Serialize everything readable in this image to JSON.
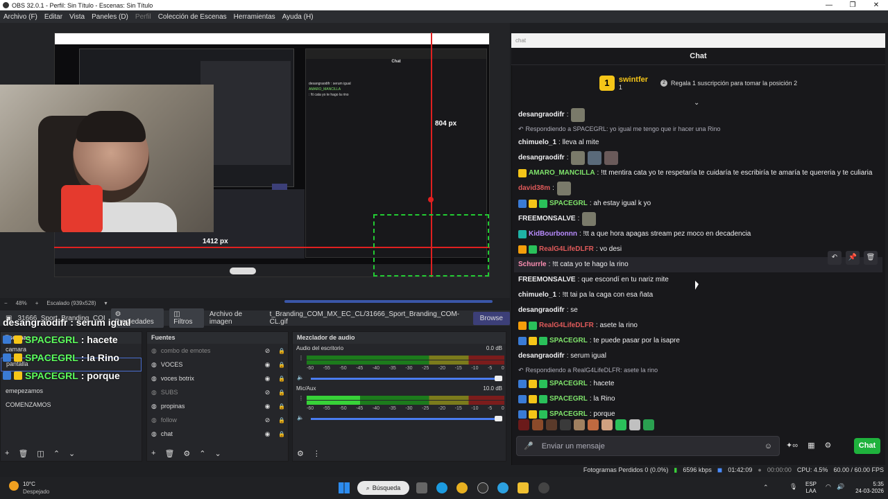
{
  "window": {
    "title": "OBS 32.0.1 - Perfil: Sin Título - Escenas: Sin Título",
    "controls": [
      "—",
      "❐",
      "✕"
    ]
  },
  "menu": [
    "Archivo (F)",
    "Editar",
    "Vista",
    "Paneles (D)",
    "Perfil",
    "Colección de Escenas",
    "Herramientas",
    "Ayuda (H)"
  ],
  "preview": {
    "label_width": "1412 px",
    "label_height": "804 px",
    "zoom": "48%",
    "scale": "Escalado (939x528)"
  },
  "properties_bar": {
    "source": "31666_Sport_Branding_COI",
    "properties": "Propiedades",
    "filters": "Filtros",
    "image_file_label": "Archivo de imagen",
    "path": "t_Branding_COM_MX_EC_CL/31666_Sport_Branding_COM-CL.gif",
    "browse": "Browse"
  },
  "overlay_chat": {
    "top": "desangraodifr : serum igual",
    "rows": [
      {
        "name": "SPACEGRL",
        "text": ": hacete"
      },
      {
        "name": "SPACEGRL",
        "text": ": la Rino"
      },
      {
        "name": "SPACEGRL",
        "text": ": porque"
      }
    ]
  },
  "scenes": {
    "title": "Escenas",
    "items": [
      "camara",
      "pantalla",
      "",
      "emepezamos",
      "COMENZAMOS"
    ]
  },
  "sources": {
    "title": "Fuentes",
    "items": [
      {
        "name": "combo de emotes",
        "visible": false
      },
      {
        "name": "VOCES",
        "visible": true
      },
      {
        "name": "voces botrix",
        "visible": true
      },
      {
        "name": "SUBS",
        "visible": false
      },
      {
        "name": "propinas",
        "visible": true
      },
      {
        "name": "follow",
        "visible": false
      },
      {
        "name": "chat",
        "visible": true
      }
    ]
  },
  "mixer": {
    "title": "Mezclador de audio",
    "channels": [
      {
        "name": "Audio del escritorio",
        "db": "0.0 dB"
      },
      {
        "name": "Mic/Aux",
        "db": "10.0 dB"
      }
    ],
    "scale": [
      "-60",
      "-55",
      "-50",
      "-45",
      "-40",
      "-35",
      "-30",
      "-25",
      "-20",
      "-15",
      "-10",
      "-5",
      "0"
    ]
  },
  "chat": {
    "addr": "chat",
    "title": "Chat",
    "pinned": {
      "rank": "1",
      "user": "swintfer",
      "count": "1",
      "gift_text": "Regala 1 suscripción para tomar la posición 2"
    },
    "messages": [
      {
        "user": "desangraodifr",
        "text": ":",
        "color": "#efeff1",
        "badges": [],
        "emotes": 1
      },
      {
        "reply": "Respondiendo a SPACEGRL: yo igual me tengo que ir hacer una Rino"
      },
      {
        "user": "chimuelo_1",
        "text": ": lleva al mite",
        "color": "#efeff1",
        "badges": [],
        "emotes": 0
      },
      {
        "user": "desangraodifr",
        "text": ":",
        "color": "#efeff1",
        "badges": [],
        "emotes": 3
      },
      {
        "user": "AMARO_MANCILLA",
        "text": ": !tt mentira cata yo te respetaría te cuidaría te escribiría te amaría te quereria y te culiaria",
        "color": "#7fe36b",
        "badges": [
          "gold"
        ],
        "emotes": 0
      },
      {
        "user": "david38m",
        "text": ":",
        "color": "#e05a5a",
        "badges": [],
        "emotes": 1
      },
      {
        "user": "SPACEGRL",
        "text": ": ah estay igual k yo",
        "color": "#7fe36b",
        "badges": [
          "blue",
          "gold",
          "green"
        ],
        "emotes": 0
      },
      {
        "user": "FREEMONSALVE",
        "text": ":",
        "color": "#efeff1",
        "badges": [],
        "emotes": 1
      },
      {
        "user": "KidBourbonnn",
        "text": ": !tt a que hora apagas stream pez moco en decadencia",
        "color": "#b98cff",
        "badges": [
          "teal"
        ],
        "emotes": 0
      },
      {
        "user": "RealG4LifeDLFR",
        "text": ": vo desi",
        "color": "#e05a5a",
        "badges": [
          "orange",
          "green"
        ],
        "emotes": 0
      },
      {
        "user": "Schurrle",
        "text": ": !tt cata yo te hago la rino",
        "color": "#ff8fb3",
        "badges": [],
        "emotes": 0,
        "highlight": true
      },
      {
        "user": "FREEMONSALVE",
        "text": ": que escondí en tu nariz mite",
        "color": "#efeff1",
        "badges": [],
        "emotes": 0
      },
      {
        "user": "chimuelo_1",
        "text": ": !tt tai pa la caga con esa ñata",
        "color": "#efeff1",
        "badges": [],
        "emotes": 0
      },
      {
        "user": "desangraodifr",
        "text": ": se",
        "color": "#efeff1",
        "badges": [],
        "emotes": 0
      },
      {
        "user": "RealG4LifeDLFR",
        "text": ": asete la rino",
        "color": "#e05a5a",
        "badges": [
          "orange",
          "green"
        ],
        "emotes": 0
      },
      {
        "user": "SPACEGRL",
        "text": ": te puede pasar por la isapre",
        "color": "#7fe36b",
        "badges": [
          "blue",
          "gold",
          "green"
        ],
        "emotes": 0
      },
      {
        "user": "desangraodifr",
        "text": ": serum igual",
        "color": "#efeff1",
        "badges": [],
        "emotes": 0
      },
      {
        "reply": "Respondiendo a RealG4LifeDLFR: asete la rino"
      },
      {
        "user": "SPACEGRL",
        "text": ": hacete",
        "color": "#7fe36b",
        "badges": [
          "blue",
          "gold",
          "green"
        ],
        "emotes": 0
      },
      {
        "user": "SPACEGRL",
        "text": ": la Rino",
        "color": "#7fe36b",
        "badges": [
          "blue",
          "gold",
          "green"
        ],
        "emotes": 0
      },
      {
        "user": "SPACEGRL",
        "text": ": porque",
        "color": "#7fe36b",
        "badges": [
          "blue",
          "gold",
          "green"
        ],
        "emotes": 0
      }
    ],
    "input_placeholder": "Enviar un mensaje",
    "send": "Chat"
  },
  "status": {
    "dropped": "Fotogramas Perdidos 0 (0.0%)",
    "bitrate": "6596 kbps",
    "stream_time": "01:42:09",
    "rec_time": "00:00:00",
    "cpu": "CPU: 4.5%",
    "fps": "60.00 / 60.00 FPS"
  },
  "taskbar": {
    "temp": "10°C",
    "weather": "Despejado",
    "search": "Búsqueda",
    "lang1": "ESP",
    "lang2": "LAA",
    "time": "5:35",
    "date": "24-03-2026"
  }
}
